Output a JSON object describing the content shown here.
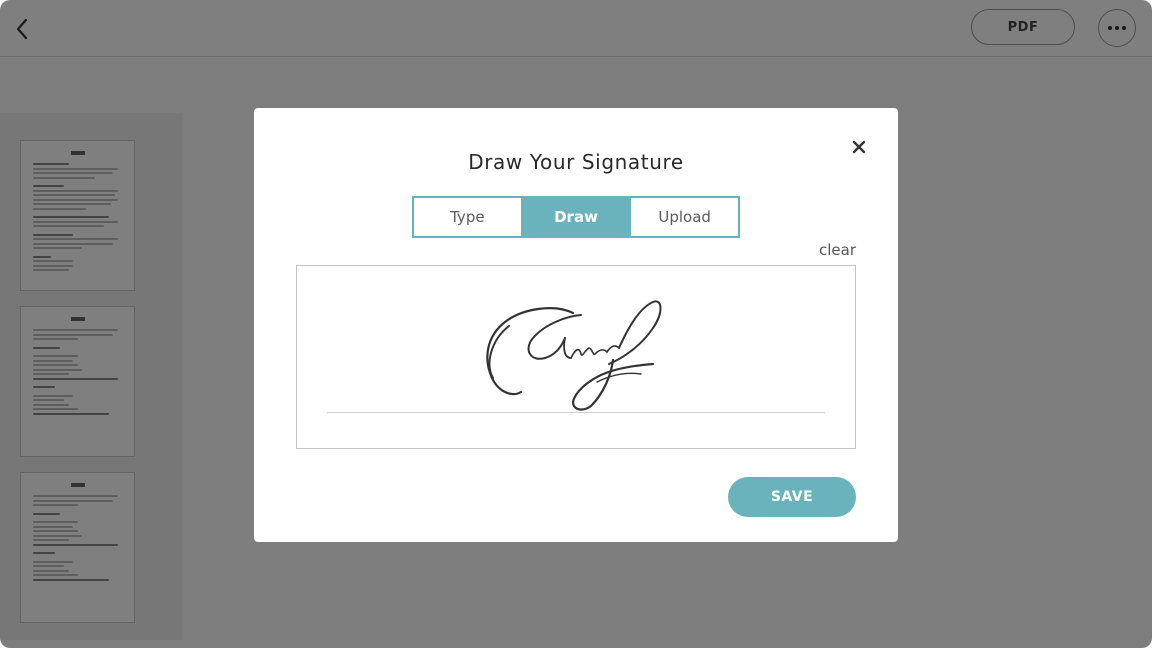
{
  "header": {
    "back_icon": "chevron-left-icon",
    "pdf_label": "PDF",
    "more_icon": "more-horizontal-icon"
  },
  "sidebar": {
    "pages": [
      {
        "page": 1
      },
      {
        "page": 2
      },
      {
        "page": 3
      }
    ]
  },
  "modal": {
    "title": "Draw Your Signature",
    "close_icon": "close-icon",
    "tabs": [
      {
        "label": "Type",
        "active": false
      },
      {
        "label": "Draw",
        "active": true
      },
      {
        "label": "Upload",
        "active": false
      }
    ],
    "clear_label": "clear",
    "save_label": "SAVE"
  },
  "colors": {
    "accent": "#6ab3bc",
    "overlay": "rgba(0,0,0,0.5)",
    "ink": "#333333"
  }
}
